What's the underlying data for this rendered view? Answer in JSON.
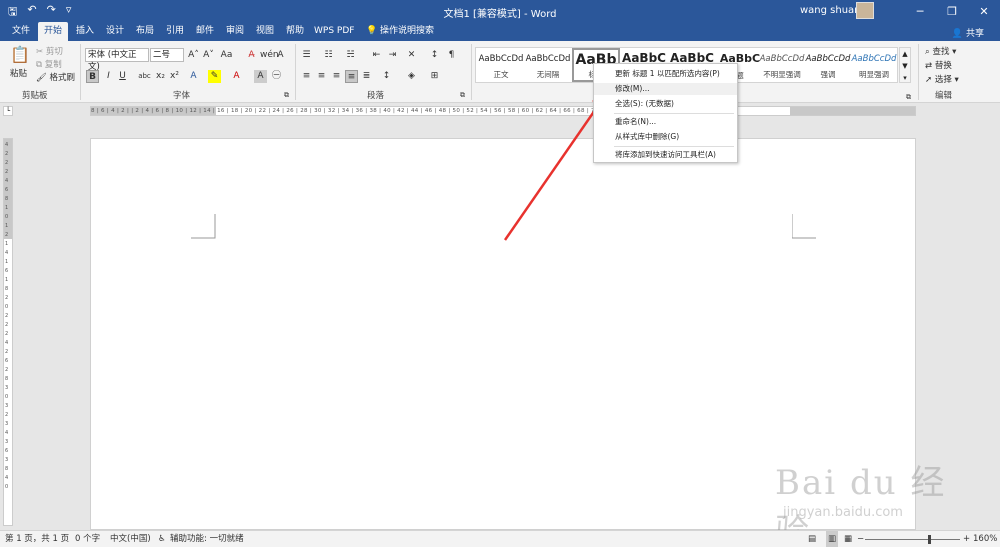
{
  "app": {
    "title": "文档1 [兼容模式] - Word",
    "user": "wang shuang",
    "share": "共享",
    "quick_access": [
      "save-icon",
      "undo-icon",
      "redo-icon",
      "customize-icon"
    ],
    "window_buttons": [
      "─",
      "❐",
      "✕"
    ]
  },
  "tabs": [
    {
      "label": "文件"
    },
    {
      "label": "开始"
    },
    {
      "label": "插入"
    },
    {
      "label": "设计"
    },
    {
      "label": "布局"
    },
    {
      "label": "引用"
    },
    {
      "label": "邮件"
    },
    {
      "label": "审阅"
    },
    {
      "label": "视图"
    },
    {
      "label": "帮助"
    },
    {
      "label": "WPS PDF"
    },
    {
      "label": "操作说明搜索"
    }
  ],
  "ribbon": {
    "clipboard": {
      "paste": "粘贴",
      "cut": "剪切",
      "copy": "复制",
      "format_painter": "格式刷",
      "label": "剪贴板"
    },
    "font": {
      "name": "宋体 (中文正文)",
      "size": "二号",
      "label": "字体"
    },
    "paragraph": {
      "label": "段落"
    },
    "styles": [
      {
        "sample": "AaBbCcDd",
        "name": "正文"
      },
      {
        "sample": "AaBbCcDd",
        "name": "无间隔"
      },
      {
        "sample": "AaBb",
        "name": "标题"
      },
      {
        "sample": "AaBbC",
        "name": ""
      },
      {
        "sample": "AaBbC",
        "name": ""
      },
      {
        "sample": "AaBbC",
        "name": "题"
      },
      {
        "sample": "AaBbCcDd",
        "name": "不明显强调"
      },
      {
        "sample": "AaBbCcDd",
        "name": "强调"
      },
      {
        "sample": "AaBbCcDd",
        "name": "明显强调"
      }
    ],
    "editing": {
      "find": "查找",
      "replace": "替换",
      "select": "选择",
      "label": "编辑"
    }
  },
  "context_menu": {
    "items": [
      "更新 标题 1 以匹配所选内容(P)",
      "修改(M)...",
      "全选(S): (无数据)",
      "重命名(N)...",
      "从样式库中删除(G)",
      "将库添加到快速访问工具栏(A)"
    ]
  },
  "status": {
    "page": "第 1 页，共 1 页",
    "words": "0 个字",
    "lang": "中文(中国)",
    "accessibility": "辅助功能: 一切就绪",
    "zoom": "160%"
  },
  "ruler": {
    "h": "8 | 6 | 4 | 2 | | 2 | 4 | 6 | 8 | 10 | 12 | 14 | 16 | 18 | 20 | 22 | 24 | 26 | 28 | 30 | 32 | 34 | 36 | 38 | 40 | 42 | 44 | 46 | 48 | 50 | 52 | 54 | 56 | 58 | 60 | 62 | 64 | 66 | 68 | 70 | 72 | 74 | 76 | 78 | 80 | 82 | 84 | 86 | 88 | 90",
    "v": "4 2 2 2 4 6 8 10 12 14 16 18 20 22 24 26 28 30 32 34 36 38 40"
  },
  "watermark": {
    "big": "Bai du 经验",
    "small": "jingyan.baidu.com"
  },
  "colors": {
    "brand": "#2b579a",
    "arrow": "#e8322e"
  }
}
